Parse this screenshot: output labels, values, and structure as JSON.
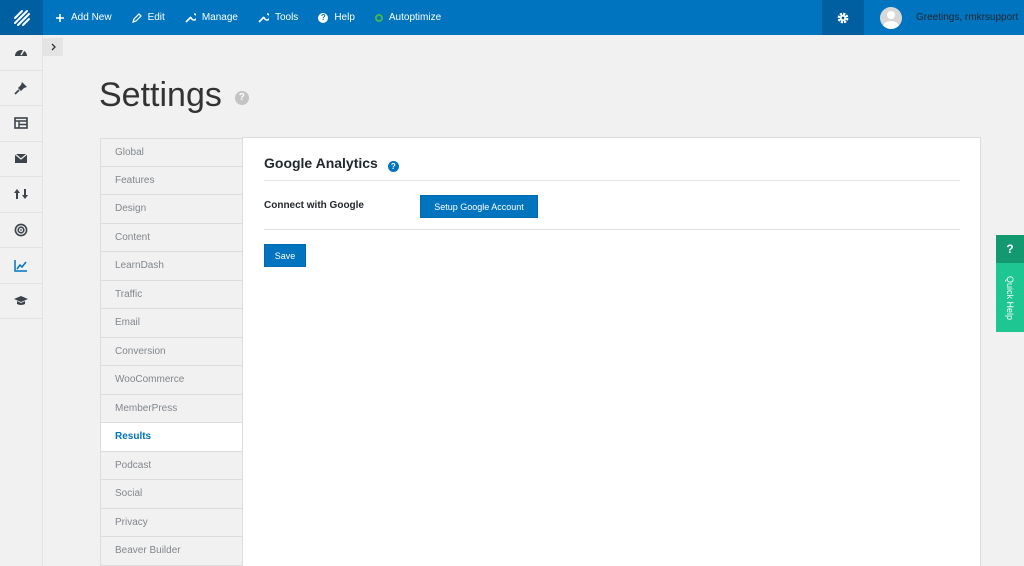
{
  "topbar": {
    "items": [
      {
        "label": "Add New",
        "icon": "plus-icon"
      },
      {
        "label": "Edit",
        "icon": "pencil-icon"
      },
      {
        "label": "Manage",
        "icon": "wrench-icon"
      },
      {
        "label": "Tools",
        "icon": "wrench-icon"
      },
      {
        "label": "Help",
        "icon": "help-icon"
      },
      {
        "label": "Autoptimize",
        "icon": "status-dot-icon"
      }
    ],
    "greeting": "Greetings, rmkrsupport"
  },
  "rail": {
    "icons": [
      "dashboard-icon",
      "pin-icon",
      "layout-icon",
      "mail-icon",
      "arrows-icon",
      "target-icon",
      "chart-icon",
      "graduation-cap-icon"
    ],
    "active_icon": "chart-icon"
  },
  "page": {
    "title": "Settings",
    "help_glyph": "?"
  },
  "tabs": [
    "Global",
    "Features",
    "Design",
    "Content",
    "LearnDash",
    "Traffic",
    "Email",
    "Conversion",
    "WooCommerce",
    "MemberPress",
    "Results",
    "Podcast",
    "Social",
    "Privacy",
    "Beaver Builder"
  ],
  "active_tab": "Results",
  "panel": {
    "heading": "Google Analytics",
    "help_glyph": "?",
    "connect_label": "Connect with Google",
    "setup_button": "Setup Google Account",
    "save_button": "Save"
  },
  "quick_help": {
    "glyph": "?",
    "label": "Quick Help"
  },
  "colors": {
    "accent": "#0074bf",
    "quick_help": "#1ec691"
  }
}
